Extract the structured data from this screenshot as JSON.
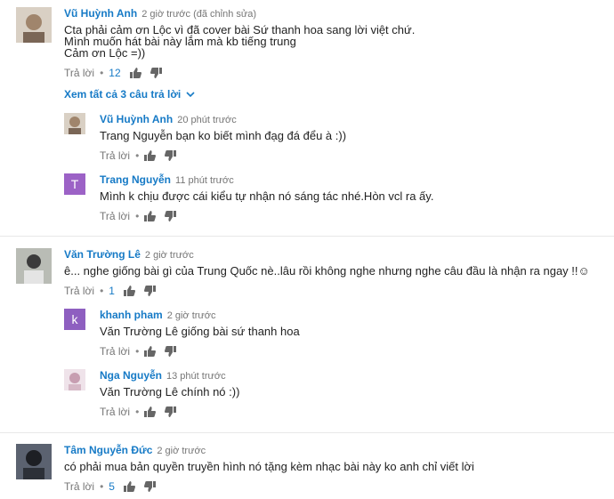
{
  "threads": [
    {
      "author": "Vũ Huỳnh Anh",
      "time": "2 giờ trước (đã chỉnh sửa)",
      "lines": [
        "Cta phải cảm ơn Lộc vì đã cover bài Sứ thanh hoa sang lời việt chứ.",
        "Mình muốn hát bài này lắm mà kb tiếng trung",
        "Cảm ơn Lộc =))"
      ],
      "reply_label": "Trả lời",
      "likes": "12",
      "avatar_color": "#c9b29a",
      "view_all": "Xem tất cả 3 câu trả lời",
      "replies": [
        {
          "author": "Vũ Huỳnh Anh",
          "time": "20 phút trước",
          "lines": [
            "Trang Nguyễn bạn ko biết mình đạg đá đểu à :))"
          ],
          "reply_label": "Trả lời",
          "likes": "",
          "avatar_color": "#c9b29a",
          "avatar_letter": ""
        },
        {
          "author": "Trang Nguyễn",
          "time": "11 phút trước",
          "lines": [
            "Mình k chịu được cái kiểu tự nhận nó sáng tác nhé.Hòn vcl ra ấy."
          ],
          "reply_label": "Trả lời",
          "likes": "",
          "avatar_color": "#9c62c6",
          "avatar_letter": "T"
        }
      ]
    },
    {
      "author": "Văn Trường Lê",
      "time": "2 giờ trước",
      "lines": [
        "ê... nghe giống bài gì của Trung Quốc nè..lâu rồi không nghe nhưng nghe câu đầu là nhận ra ngay !!☺"
      ],
      "reply_label": "Trả lời",
      "likes": "1",
      "avatar_color": "#8a8e86",
      "replies": [
        {
          "author": "khanh pham",
          "time": "2 giờ trước",
          "lines": [
            "Văn Trường Lê giống bài sứ thanh hoa"
          ],
          "reply_label": "Trả lời",
          "likes": "",
          "avatar_color": "#8e5fc0",
          "avatar_letter": "k"
        },
        {
          "author": "Nga Nguyễn",
          "time": "13 phút trước",
          "lines": [
            "Văn Trường Lê chính nó :))"
          ],
          "reply_label": "Trả lời",
          "likes": "",
          "avatar_color": "#d8c4d0",
          "avatar_letter": ""
        }
      ]
    },
    {
      "author": "Tâm Nguyễn Đức",
      "time": "2 giờ trước",
      "lines": [
        "có phải mua bản quyền truyền hình nó tặng kèm nhạc bài này ko anh chỉ viết lời"
      ],
      "reply_label": "Trả lời",
      "likes": "5",
      "avatar_color": "#3a3f4a",
      "replies": []
    }
  ],
  "colors": {
    "author": "#167ac6",
    "meta": "#767676",
    "text": "#222222"
  },
  "icons": {
    "like": "thumbs-up-icon",
    "dislike": "thumbs-down-icon",
    "expand": "chevron-down-icon"
  }
}
